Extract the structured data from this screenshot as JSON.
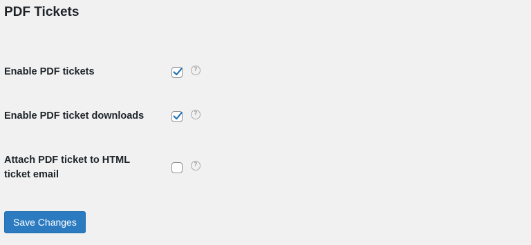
{
  "page": {
    "title": "PDF Tickets"
  },
  "settings": [
    {
      "label": "Enable PDF tickets",
      "checked": true,
      "help_icon": "question-circle-icon"
    },
    {
      "label": "Enable PDF ticket downloads",
      "checked": true,
      "help_icon": "question-circle-icon"
    },
    {
      "label": "Attach PDF ticket to HTML ticket email",
      "checked": false,
      "help_icon": "question-circle-icon"
    }
  ],
  "help_glyph": "?",
  "actions": {
    "save_label": "Save Changes"
  },
  "colors": {
    "background": "#f1f1f1",
    "primary_button": "#2c7bc0",
    "checkmark": "#2271b1",
    "text": "#1d2327",
    "help_icon": "#a7aaad"
  }
}
